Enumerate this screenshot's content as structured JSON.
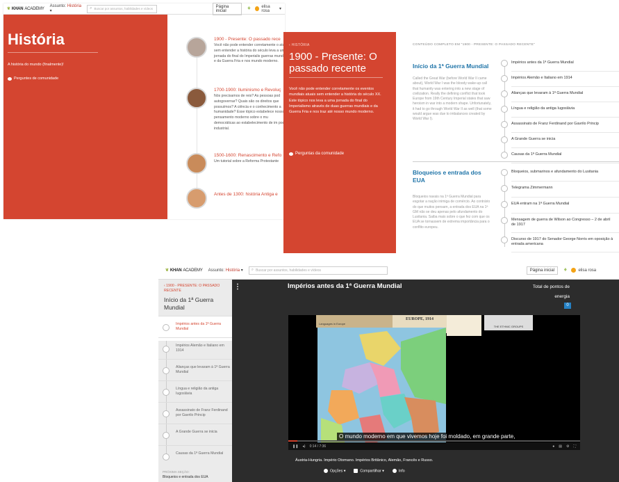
{
  "topbar": {
    "logo_prefix": "KHAN",
    "logo_suffix": "ACADEMY",
    "assunto_label": "Assunto:",
    "assunto_value": "História",
    "search_placeholder": "Buscar por assuntos, habilidades e vídeos",
    "home_button": "Página inicial",
    "user_name": "elisa rosa"
  },
  "panel1": {
    "page_title": "História",
    "subtitle": "A história do mundo (finalmente)!",
    "community": "Perguntes de comunidade",
    "topics": [
      {
        "title": "1900 - Presente: O passado rece",
        "desc": "Você não pode entender corretamente o atuais sem entender a história do século leva a uma jornada do final do Imperialis guerras mundiais e da Guerra Fria e nos mundo moderno."
      },
      {
        "title": "1700-1900: Iluminismo e Revoluç",
        "desc": "Nós precisamos de reis? As pessoas pod autogovernar? Quais são os direitos que possuímos? A ciência e o conhecimento a humanidade? Esse tópico estabelece nosso pensamento moderno sobre o mu democráticas ao estabelecimento de im poder industrial."
      },
      {
        "title": "1500-1600: Renascimento e Refo",
        "desc": "Um tutorial sobre a Reforma Protestante"
      },
      {
        "title": "Antes de 1300: história Antiga e",
        "desc": ""
      }
    ]
  },
  "panel2": {
    "kicker": "‹ HISTÓRIA",
    "title": "1900 - Presente: O passado recente",
    "desc": "Você não pode entender corretamente os eventos mundiais atuais sem entender a história do século XX. Este tópico nos leva a uma jornada do final do Imperialismo através de duas guerras mundiais e da Guerra Fria e nos traz até nosso mundo moderno.",
    "community": "Perguntas da comunidade",
    "content_header": "CONTEÚDO COMPLETO EM \"1900 - PRESENTE: O PASSADO RECENTE\"",
    "sections": [
      {
        "title": "Início da 1ª Guerra Mundial",
        "desc": "Called the Great War (before World War II came about), World War I was the bloody wake-up call that humanity was entering into a new stage of civilization. Really the defining conflict that took Europe from 19th Century Imperial states that saw heroism in war into a modern shape. Unfortunately, it had to go through World War II as well (that some would argue was due to imbalances created by World War I).",
        "lessons": [
          "Impérios antes da 1ª Guerra Mundial",
          "Impérios Alemão e Italiano em 1914",
          "Alianças que levaram à 1ª Guerra Mundial",
          "Língua e religião da antiga Iugoslávia",
          "Assassinato de Franz Ferdinand por Gavrilo Princip",
          "A Grande Guerra se inicia",
          "Causas da 1ª Guerra Mundial"
        ]
      },
      {
        "title": "Bloqueios e entrada dos EUA",
        "desc": "Bloqueios navais na 1ª Guerra Mundial para esgotar a nação inimiga de comércio. Ao contrário do que muitos pensam, a entrada dos EUA na 1ª GM não se deu apenas pelo afundamento do Lusitania. Saiba mais sobre o que fez com que os EUA se tornassem de extrema importância para o conflito europeu.",
        "lessons": [
          "Bloqueios, submarinos e afundamento do Lusitania",
          "Telegrama Zimmermann",
          "EUA entram na 1ª Guerra Mundial",
          "Mensagem de guerra de Wilson ao Congresso – 2 de abril de 1917",
          "Discurso de 1917 do Senador George Norris em oposição à entrada americana"
        ]
      }
    ]
  },
  "panel3": {
    "crumb": "‹ 1900 - PRESENTE: O PASSADO RECENTE",
    "section_title": "Início da 1ª Guerra Mundial",
    "lessons": [
      "Impérios antes da 1ª Guerra Mundial",
      "Impérios Alemão e Italiano em 1914",
      "Alianças que levaram à 1ª Guerra Mundial",
      "Língua e religião da antiga Iugoslávia",
      "Assassinato de Franz Ferdinand por Gavrilo Princip",
      "A Grande Guerra se inicia",
      "Causas da 1ª Guerra Mundial"
    ],
    "next_label": "PRÓXIMA SEÇÃO:",
    "next_value": "Bloqueios e entrada dos EUA",
    "video_title": "Impérios antes da 1ª Guerra Mundial",
    "points_label_1": "Total de pontos de",
    "points_label_2": "energia",
    "points_value": "0",
    "map_title": "EUROPE, 1914",
    "map_inset_left": "Languages in Europe",
    "map_inset_right": "THE ETHNIC GROUPS",
    "subtitle": "O mundo moderno em que vivemos hoje foi moldado, em grande parte,",
    "time": "0:14 / 7:36",
    "progress": 0.03,
    "caption": "Áustria-Hungria. Império Otomano. Impérios Britânico, Alemão, Francês e Russo.",
    "action_options": "Opções ▾",
    "action_share": "Compartilhar ▾",
    "action_info": "Info"
  },
  "colors": {
    "khan_red": "#d44530",
    "link_blue": "#1f74a8",
    "leaf_green": "#9cb443"
  }
}
